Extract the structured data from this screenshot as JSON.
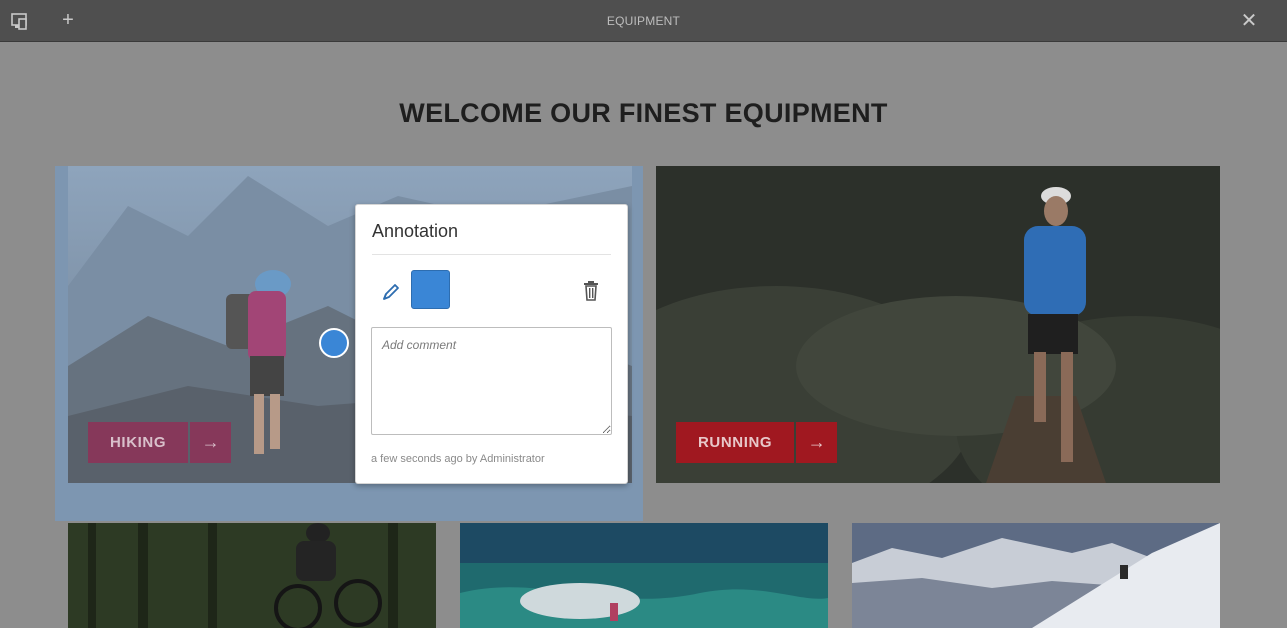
{
  "topbar": {
    "title": "EQUIPMENT",
    "icons": [
      "emulator-icon",
      "plus-icon",
      "close-icon"
    ]
  },
  "page": {
    "heading": "WELCOME OUR FINEST EQUIPMENT"
  },
  "tiles": {
    "hiking": {
      "label": "HIKING",
      "arrow": "→"
    },
    "running": {
      "label": "RUNNING",
      "arrow": "→"
    }
  },
  "annotation": {
    "title": "Annotation",
    "color": "#3a86d6",
    "comment_placeholder": "Add comment",
    "meta": "a few seconds ago by Administrator"
  },
  "colors": {
    "accent_red": "#a01820",
    "selection": "#7d96b1",
    "topbar": "#4f4f4f"
  }
}
